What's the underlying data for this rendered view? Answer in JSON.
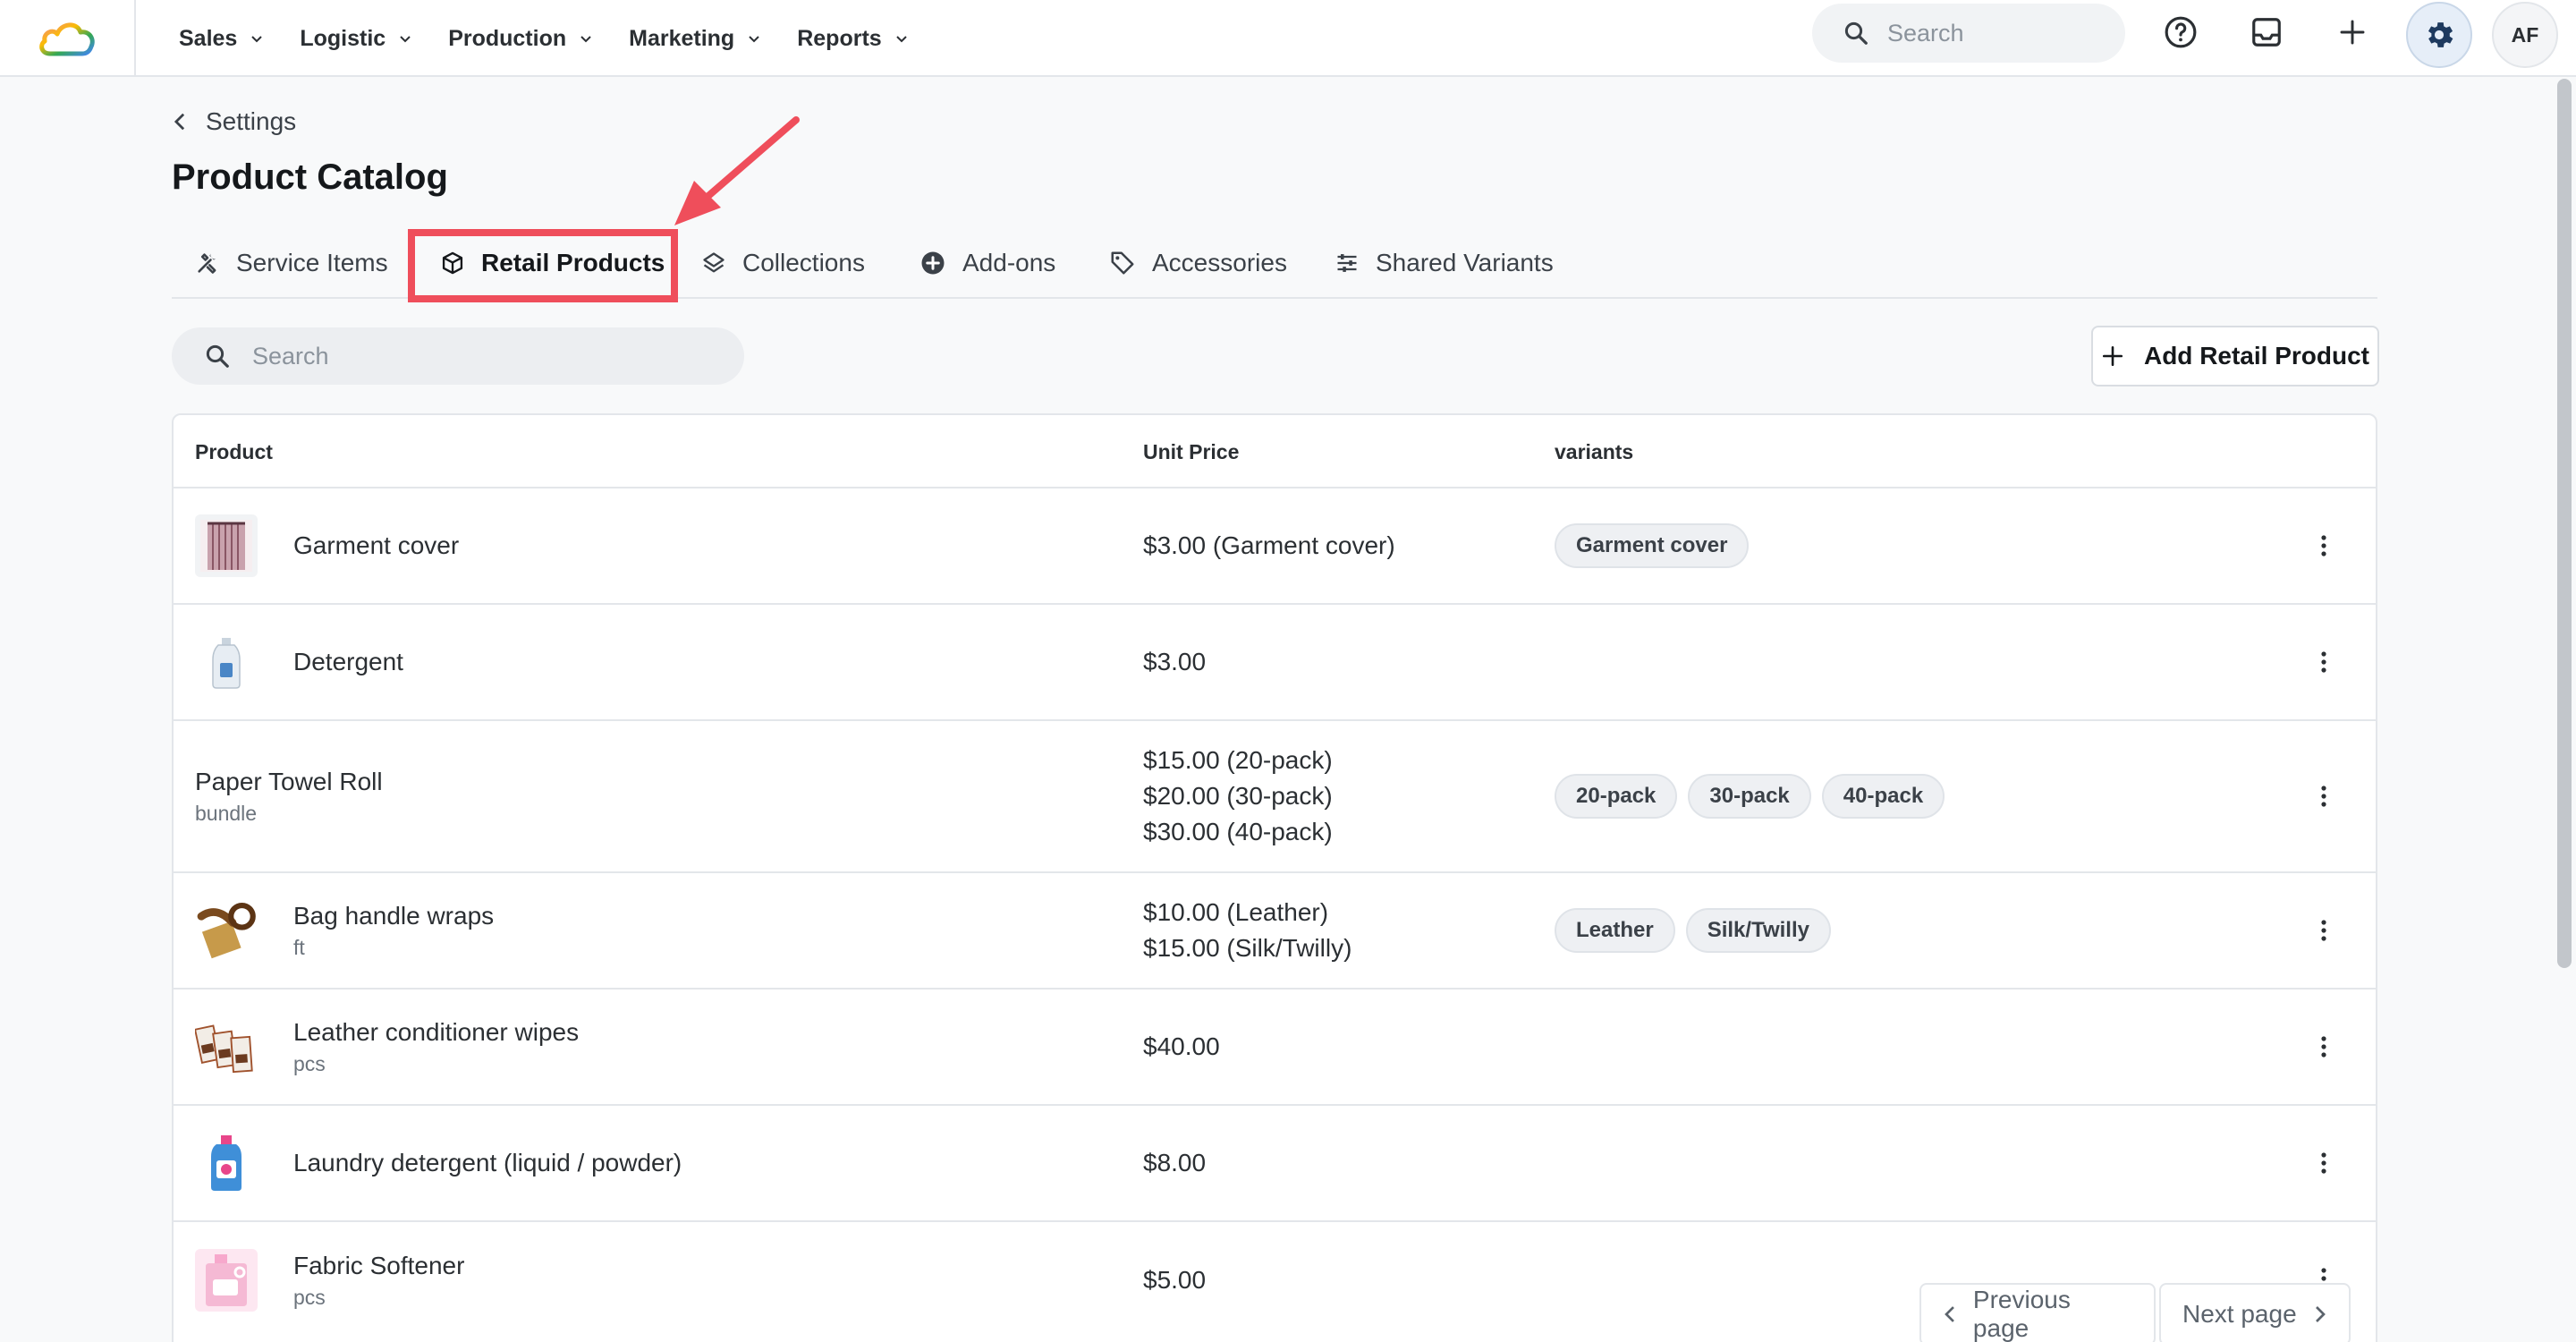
{
  "nav": {
    "items": [
      {
        "label": "Sales"
      },
      {
        "label": "Logistic"
      },
      {
        "label": "Production"
      },
      {
        "label": "Marketing"
      },
      {
        "label": "Reports"
      }
    ],
    "search_placeholder": "Search",
    "avatar_initials": "AF"
  },
  "header": {
    "back_label": "Settings",
    "title": "Product Catalog"
  },
  "tabs": [
    {
      "label": "Service Items",
      "icon": "tools-icon"
    },
    {
      "label": "Retail Products",
      "icon": "box-icon",
      "active": true
    },
    {
      "label": "Collections",
      "icon": "layers-icon"
    },
    {
      "label": "Add-ons",
      "icon": "plus-circle-icon"
    },
    {
      "label": "Accessories",
      "icon": "tag-icon"
    },
    {
      "label": "Shared Variants",
      "icon": "sliders-icon"
    }
  ],
  "toolbar": {
    "search_placeholder": "Search",
    "add_label": "Add Retail Product"
  },
  "table": {
    "columns": {
      "product": "Product",
      "price": "Unit Price",
      "variants": "variants"
    },
    "rows": [
      {
        "name": "Garment cover",
        "sub": "",
        "thumb": "garment-cover-image",
        "prices": [
          "$3.00 (Garment cover)"
        ],
        "variants": [
          "Garment cover"
        ]
      },
      {
        "name": "Detergent",
        "sub": "",
        "thumb": "detergent-bottle-image",
        "prices": [
          "$3.00"
        ],
        "variants": []
      },
      {
        "name": "Paper Towel Roll",
        "sub": "bundle",
        "thumb": "",
        "prices": [
          "$15.00 (20-pack)",
          "$20.00 (30-pack)",
          "$30.00 (40-pack)"
        ],
        "variants": [
          "20-pack",
          "30-pack",
          "40-pack"
        ]
      },
      {
        "name": "Bag handle wraps",
        "sub": "ft",
        "thumb": "leather-wraps-image",
        "prices": [
          "$10.00 (Leather)",
          "$15.00 (Silk/Twilly)"
        ],
        "variants": [
          "Leather",
          "Silk/Twilly"
        ]
      },
      {
        "name": "Leather conditioner wipes",
        "sub": "pcs",
        "thumb": "wipes-image",
        "prices": [
          "$40.00"
        ],
        "variants": []
      },
      {
        "name": "Laundry detergent (liquid / powder)",
        "sub": "",
        "thumb": "laundry-detergent-image",
        "prices": [
          "$8.00"
        ],
        "variants": []
      },
      {
        "name": "Fabric Softener",
        "sub": "pcs",
        "thumb": "fabric-softener-image",
        "prices": [
          "$5.00"
        ],
        "variants": []
      }
    ]
  },
  "pagination": {
    "prev_label": "Previous page",
    "next_label": "Next page"
  },
  "colors": {
    "highlight": "#ef4e5b",
    "accent": "#1e3a5f"
  }
}
